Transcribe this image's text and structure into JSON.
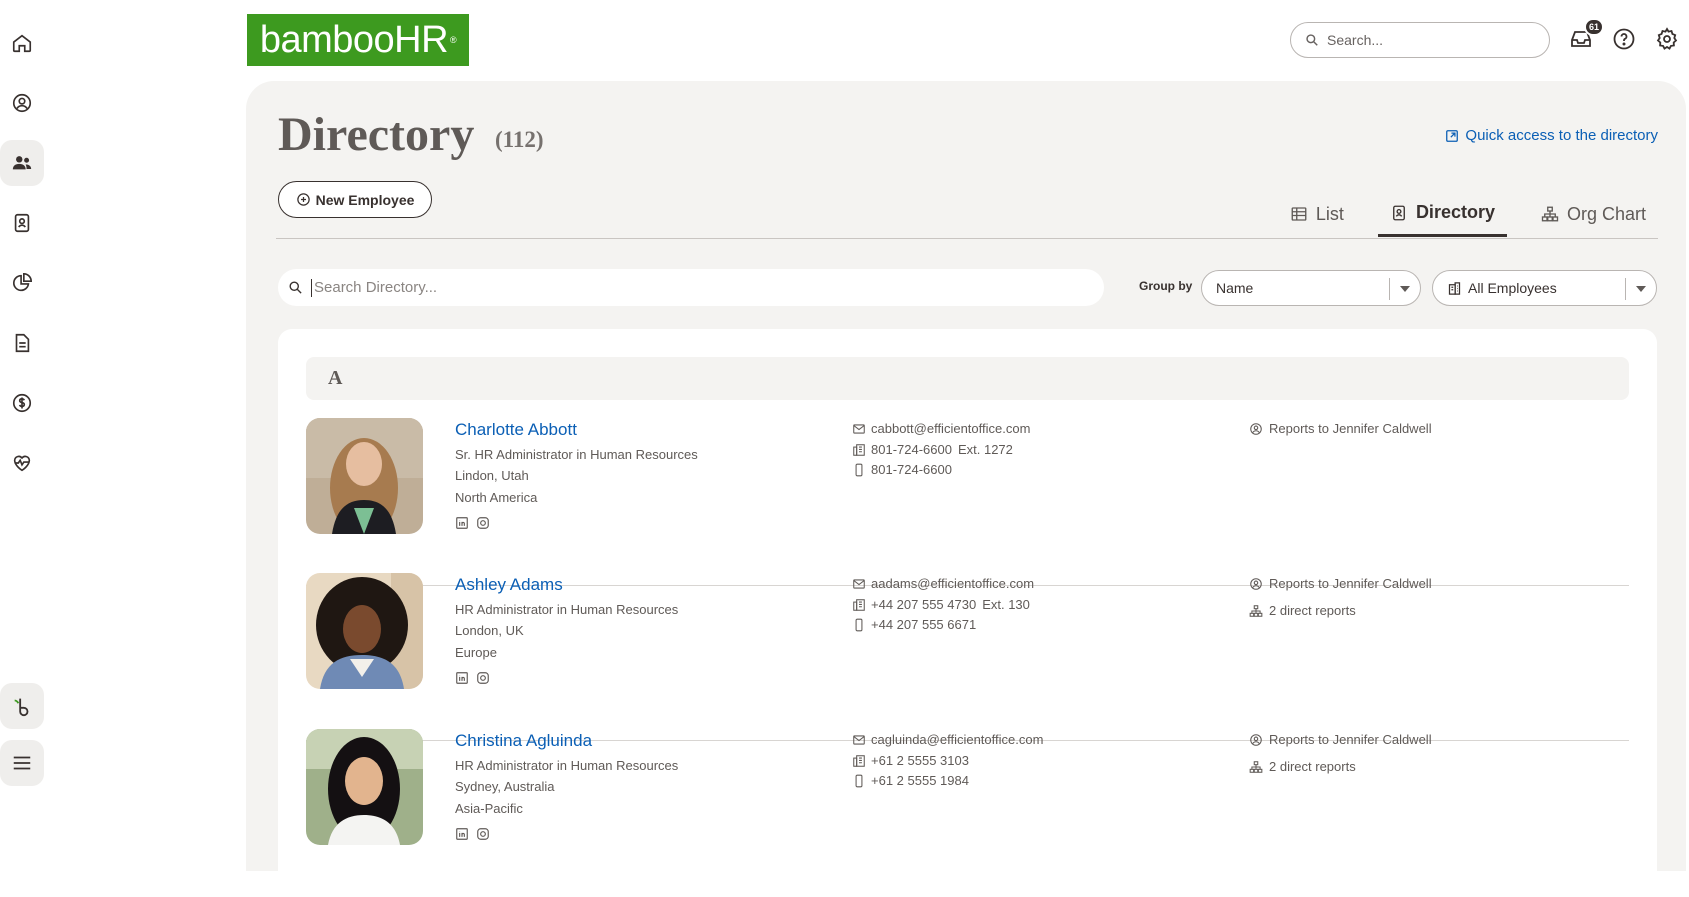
{
  "sidebar": {
    "items": [
      {
        "icon": "home-icon"
      },
      {
        "icon": "user-circle-icon"
      },
      {
        "icon": "people-icon"
      },
      {
        "icon": "badge-icon"
      },
      {
        "icon": "pie-chart-icon"
      },
      {
        "icon": "document-icon"
      },
      {
        "icon": "dollar-icon"
      },
      {
        "icon": "heart-pulse-icon"
      }
    ],
    "bottom": [
      {
        "icon": "bamboo-b-icon"
      },
      {
        "icon": "menu-icon"
      }
    ]
  },
  "header": {
    "logo_text": "bambooHR",
    "logo_mark": "®",
    "search_placeholder": "Search...",
    "inbox_badge": "61"
  },
  "page": {
    "title": "Directory",
    "count": "(112)",
    "quick_access": "Quick access to the directory",
    "new_employee": "New Employee",
    "tabs": [
      {
        "label": "List",
        "active": false
      },
      {
        "label": "Directory",
        "active": true
      },
      {
        "label": "Org Chart",
        "active": false
      }
    ],
    "search_placeholder": "Search Directory...",
    "group_by_label": "Group by",
    "group_by_value": "Name",
    "filter_value": "All Employees",
    "section_letter": "A"
  },
  "employees": [
    {
      "name": "Charlotte Abbott",
      "title": "Sr. HR Administrator in Human Resources",
      "location": "Lindon, Utah",
      "region": "North America",
      "email": "cabbott@efficientoffice.com",
      "work_phone": "801-724-6600",
      "ext": "Ext. 1272",
      "mobile": "801-724-6600",
      "reports_to": "Reports to Jennifer Caldwell",
      "direct_reports": ""
    },
    {
      "name": "Ashley Adams",
      "title": "HR Administrator in Human Resources",
      "location": "London, UK",
      "region": "Europe",
      "email": "aadams@efficientoffice.com",
      "work_phone": "+44 207 555 4730",
      "ext": "Ext. 130",
      "mobile": "+44 207 555 6671",
      "reports_to": "Reports to Jennifer Caldwell",
      "direct_reports": "2 direct reports"
    },
    {
      "name": "Christina Agluinda",
      "title": "HR Administrator in Human Resources",
      "location": "Sydney, Australia",
      "region": "Asia-Pacific",
      "email": "cagluinda@efficientoffice.com",
      "work_phone": "+61 2 5555 3103",
      "ext": "",
      "mobile": "+61 2 5555 1984",
      "reports_to": "Reports to Jennifer Caldwell",
      "direct_reports": "2 direct reports"
    }
  ],
  "colors": {
    "brand": "#3d9a1f",
    "link": "#0b5fb5",
    "text": "#38312f",
    "panel": "#f4f3f1"
  }
}
